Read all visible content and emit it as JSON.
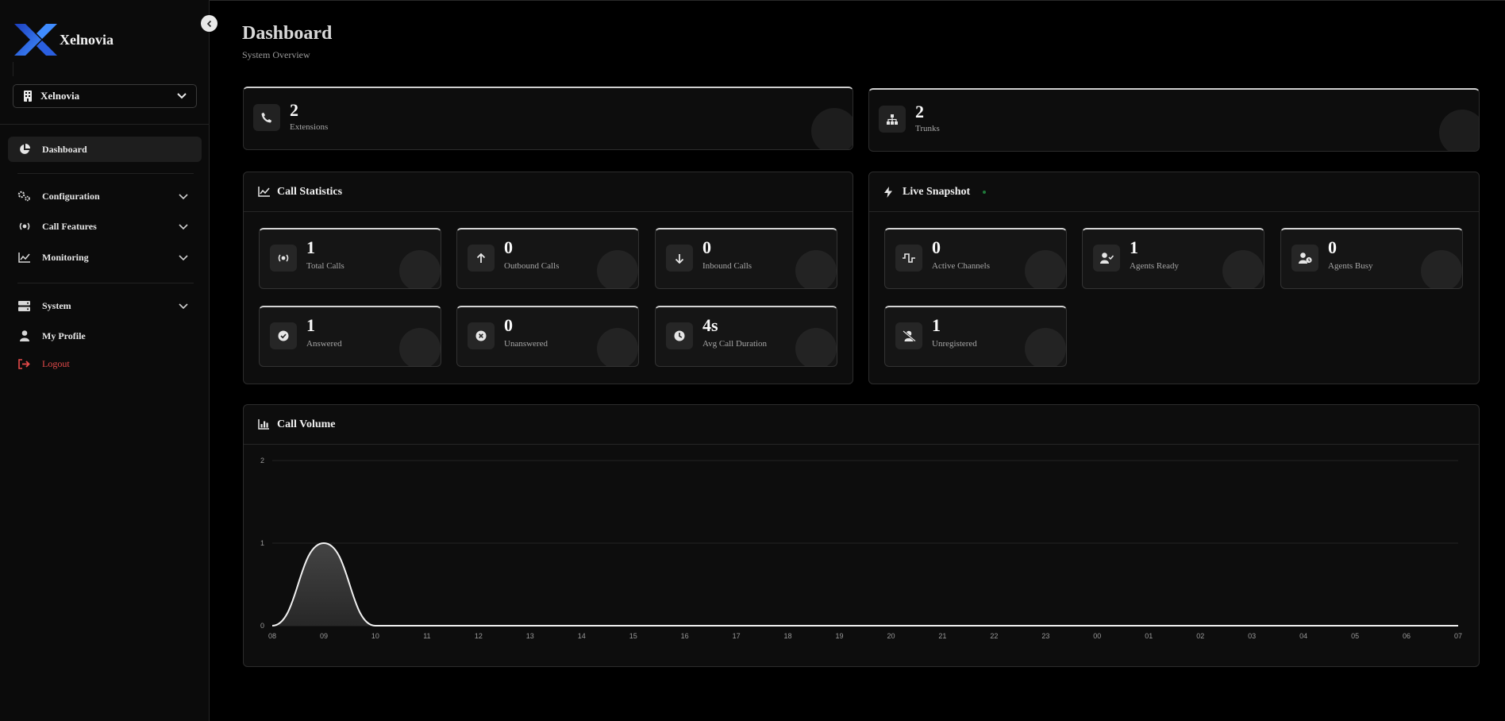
{
  "app": {
    "brand": "Xelnovia",
    "tenant": "Xelnovia"
  },
  "sidebar": {
    "items": [
      {
        "label": "Dashboard",
        "icon": "pie-chart-icon",
        "active": true
      },
      {
        "label": "Configuration",
        "icon": "gears-icon"
      },
      {
        "label": "Call Features",
        "icon": "signal-phone-icon"
      },
      {
        "label": "Monitoring",
        "icon": "line-chart-icon"
      },
      {
        "label": "System",
        "icon": "server-icon"
      },
      {
        "label": "My Profile",
        "icon": "user-icon"
      },
      {
        "label": "Logout",
        "icon": "logout-icon"
      }
    ]
  },
  "header": {
    "title": "Dashboard",
    "subtitle": "System Overview"
  },
  "summary": [
    {
      "value": "2",
      "label": "Extensions",
      "icon": "phone-icon"
    },
    {
      "value": "2",
      "label": "Trunks",
      "icon": "sitemap-icon"
    }
  ],
  "call_statistics": {
    "title": "Call Statistics",
    "stats": [
      {
        "value": "1",
        "label": "Total Calls",
        "icon": "phone-volume-icon"
      },
      {
        "value": "0",
        "label": "Outbound Calls",
        "icon": "arrow-up-icon"
      },
      {
        "value": "0",
        "label": "Inbound Calls",
        "icon": "arrow-down-icon"
      },
      {
        "value": "1",
        "label": "Answered",
        "icon": "check-circle-icon"
      },
      {
        "value": "0",
        "label": "Unanswered",
        "icon": "x-circle-icon"
      },
      {
        "value": "4s",
        "label": "Avg Call Duration",
        "icon": "clock-icon"
      }
    ]
  },
  "live_snapshot": {
    "title": "Live Snapshot",
    "status_color": "#1f7a3a",
    "stats": [
      {
        "value": "0",
        "label": "Active Channels",
        "icon": "wave-square-icon"
      },
      {
        "value": "1",
        "label": "Agents Ready",
        "icon": "user-check-icon"
      },
      {
        "value": "0",
        "label": "Agents Busy",
        "icon": "user-clock-icon"
      },
      {
        "value": "1",
        "label": "Unregistered",
        "icon": "user-slash-icon"
      }
    ]
  },
  "call_volume": {
    "title": "Call Volume"
  },
  "chart_data": {
    "type": "area",
    "x": [
      "08",
      "09",
      "10",
      "11",
      "12",
      "13",
      "14",
      "15",
      "16",
      "17",
      "18",
      "19",
      "20",
      "21",
      "22",
      "23",
      "00",
      "01",
      "02",
      "03",
      "04",
      "05",
      "06",
      "07"
    ],
    "values": [
      0,
      1,
      0,
      0,
      0,
      0,
      0,
      0,
      0,
      0,
      0,
      0,
      0,
      0,
      0,
      0,
      0,
      0,
      0,
      0,
      0,
      0,
      0,
      0
    ],
    "y_ticks": [
      "0",
      "1",
      "2"
    ],
    "ylim": [
      0,
      2
    ],
    "grid": true
  }
}
